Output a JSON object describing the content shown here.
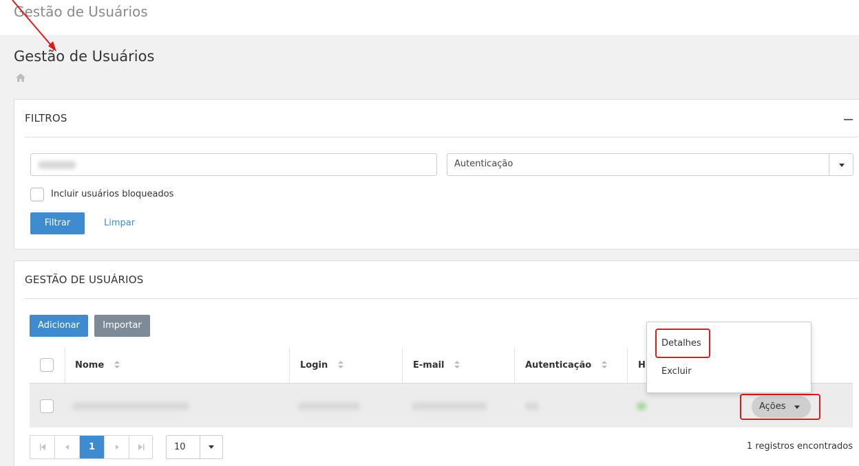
{
  "app": {
    "title": "Gestão de Usuários"
  },
  "page": {
    "title": "Gestão de Usuários"
  },
  "filters": {
    "heading": "FILTROS",
    "auth_select": "Autenticação",
    "include_blocked_label": "Incluir usuários bloqueados",
    "filter_button": "Filtrar",
    "clear_link": "Limpar"
  },
  "users": {
    "heading": "GESTÃO DE USUÁRIOS",
    "add_button": "Adicionar",
    "import_button": "Importar",
    "columns": {
      "name": "Nome",
      "login": "Login",
      "email": "E-mail",
      "auth": "Autenticação",
      "extra": "H"
    },
    "actions_button": "Ações",
    "dropdown": {
      "details": "Detalhes",
      "delete": "Excluir"
    },
    "pagination": {
      "current_page": "1",
      "page_size": "10",
      "records": "1 registros encontrados"
    }
  },
  "colors": {
    "primary": "#3f8bd0",
    "secondary": "#7d8b99",
    "highlight": "#e01818"
  }
}
